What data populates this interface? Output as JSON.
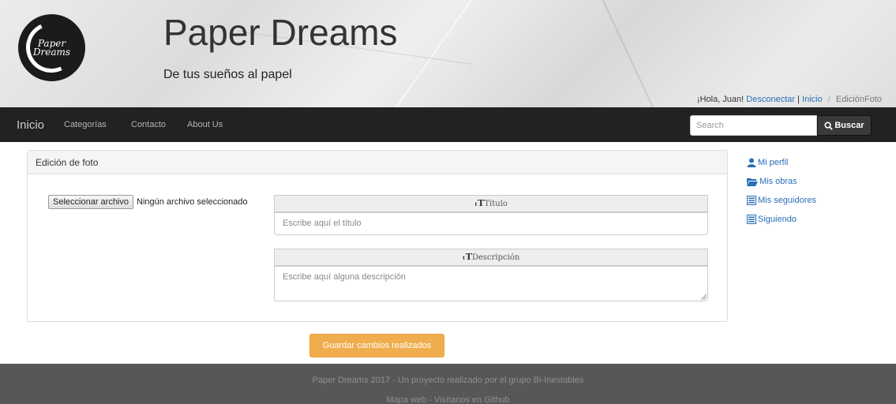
{
  "header": {
    "logo_text": "Paper Dreams",
    "title": "Paper Dreams",
    "subtitle": "De tus sueños al papel",
    "greeting": "¡Hola, Juan!",
    "logout_link": "Desconectar",
    "separator": "|",
    "home_link": "Inicio",
    "breadcrumb_sep": "/",
    "current_page": "EdiciónFoto"
  },
  "navbar": {
    "brand": "Inicio",
    "links": [
      "Categorías",
      "Contacto",
      "About Us"
    ],
    "search_placeholder": "Search",
    "search_button": "Buscar"
  },
  "panel": {
    "heading": "Edición de foto",
    "file_button": "Seleccionar archivo",
    "file_status": "Ningún archivo seleccionado",
    "title_label": "Título",
    "title_placeholder": "Escribe aquí el título",
    "description_label": "Descripción",
    "description_placeholder": "Escribe aquí alguna descripción"
  },
  "sidebar": {
    "items": [
      {
        "label": "Mi perfil",
        "icon": "user-icon"
      },
      {
        "label": "Mis obras",
        "icon": "folder-open-icon"
      },
      {
        "label": "Mis seguidores",
        "icon": "list-icon"
      },
      {
        "label": "Siguiendo",
        "icon": "list-icon"
      }
    ]
  },
  "save_button": "Guardar cambios realizados",
  "footer": {
    "line1": "Paper Dreams 2017 - Un proyecto realizado por el grupo Bi-Inestables",
    "sitemap": "Mapa web",
    "dash": "-",
    "github": "Visítanos en Github"
  },
  "colors": {
    "navbar": "#222222",
    "link": "#2a6db8",
    "save_button": "#f0ad4e",
    "footer": "#575757"
  }
}
